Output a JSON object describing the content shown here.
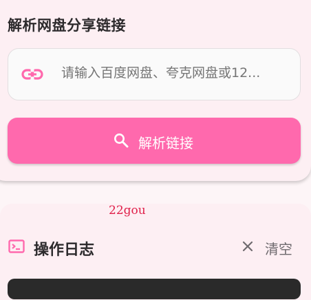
{
  "header": {
    "title": "解析网盘分享链接"
  },
  "link_input": {
    "placeholder": "请输入百度网盘、夸克网盘或12...",
    "icon": "link-icon"
  },
  "parse_button": {
    "label": "解析链接",
    "icon": "search-icon"
  },
  "watermark": "22gou",
  "log_section": {
    "icon": "terminal-icon",
    "title": "操作日志",
    "clear_button": {
      "label": "清空",
      "icon": "close-icon"
    }
  },
  "colors": {
    "accent": "#ff69ad",
    "card_background": "#fdeff3",
    "page_background": "#fdf5f7",
    "console_background": "#2a2a2a",
    "watermark": "#e0204a"
  }
}
